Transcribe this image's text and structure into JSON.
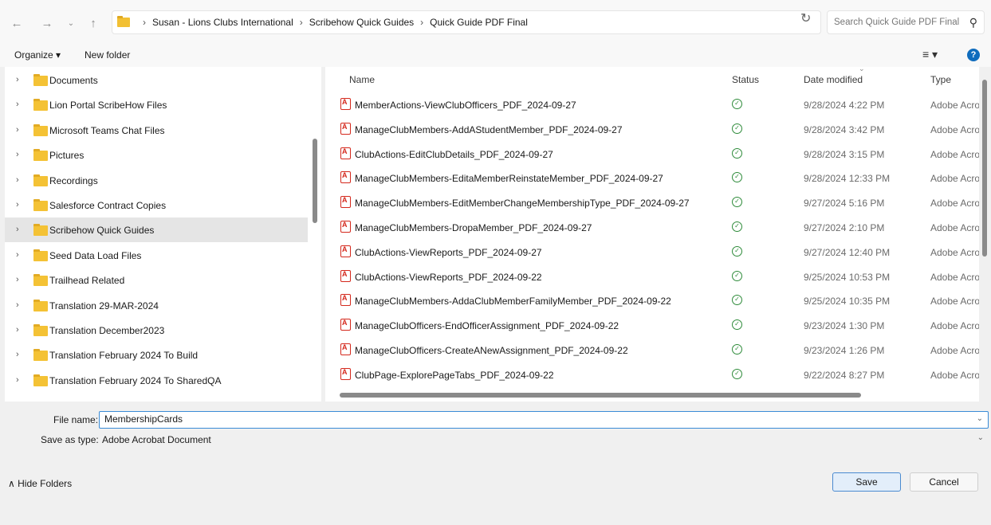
{
  "address_bar": {
    "crumbs": [
      "Susan - Lions Clubs International",
      "Scribehow Quick Guides",
      "Quick Guide PDF Final"
    ],
    "search_placeholder": "Search Quick Guide PDF Final"
  },
  "toolbar": {
    "organize_label": "Organize ▾",
    "new_folder_label": "New folder"
  },
  "nav_tree": [
    {
      "label": "Documents"
    },
    {
      "label": "Lion Portal ScribeHow Files"
    },
    {
      "label": "Microsoft Teams Chat Files"
    },
    {
      "label": "Pictures"
    },
    {
      "label": "Recordings"
    },
    {
      "label": "Salesforce Contract Copies"
    },
    {
      "label": "Scribehow Quick Guides",
      "selected": true
    },
    {
      "label": "Seed Data Load Files"
    },
    {
      "label": "Trailhead Related"
    },
    {
      "label": "Translation 29-MAR-2024"
    },
    {
      "label": "Translation December2023"
    },
    {
      "label": "Translation February 2024 To Build"
    },
    {
      "label": "Translation February 2024 To SharedQA"
    }
  ],
  "columns": {
    "name": "Name",
    "status": "Status",
    "date_modified": "Date modified",
    "type": "Type"
  },
  "files": [
    {
      "name": "MemberActions-ViewClubOfficers_PDF_2024-09-27",
      "date": "9/28/2024 4:22 PM",
      "type": "Adobe Acro"
    },
    {
      "name": "ManageClubMembers-AddAStudentMember_PDF_2024-09-27",
      "date": "9/28/2024 3:42 PM",
      "type": "Adobe Acro"
    },
    {
      "name": "ClubActions-EditClubDetails_PDF_2024-09-27",
      "date": "9/28/2024 3:15 PM",
      "type": "Adobe Acro"
    },
    {
      "name": "ManageClubMembers-EditaMemberReinstateMember_PDF_2024-09-27",
      "date": "9/28/2024 12:33 PM",
      "type": "Adobe Acro"
    },
    {
      "name": "ManageClubMembers-EditMemberChangeMembershipType_PDF_2024-09-27",
      "date": "9/27/2024 5:16 PM",
      "type": "Adobe Acro"
    },
    {
      "name": "ManageClubMembers-DropaMember_PDF_2024-09-27",
      "date": "9/27/2024 2:10 PM",
      "type": "Adobe Acro"
    },
    {
      "name": "ClubActions-ViewReports_PDF_2024-09-27",
      "date": "9/27/2024 12:40 PM",
      "type": "Adobe Acro"
    },
    {
      "name": "ClubActions-ViewReports_PDF_2024-09-22",
      "date": "9/25/2024 10:53 PM",
      "type": "Adobe Acro"
    },
    {
      "name": "ManageClubMembers-AddaClubMemberFamilyMember_PDF_2024-09-22",
      "date": "9/25/2024 10:35 PM",
      "type": "Adobe Acro"
    },
    {
      "name": "ManageClubOfficers-EndOfficerAssignment_PDF_2024-09-22",
      "date": "9/23/2024 1:30 PM",
      "type": "Adobe Acro"
    },
    {
      "name": "ManageClubOfficers-CreateANewAssignment_PDF_2024-09-22",
      "date": "9/23/2024 1:26 PM",
      "type": "Adobe Acro"
    },
    {
      "name": "ClubPage-ExplorePageTabs_PDF_2024-09-22",
      "date": "9/22/2024 8:27 PM",
      "type": "Adobe Acro"
    }
  ],
  "form": {
    "file_name_label": "File name:",
    "file_name_value": "MembershipCards",
    "save_type_label": "Save as type:",
    "save_type_value": "Adobe Acrobat Document"
  },
  "footer": {
    "hide_folders": "∧ Hide Folders",
    "save": "Save",
    "cancel": "Cancel"
  }
}
